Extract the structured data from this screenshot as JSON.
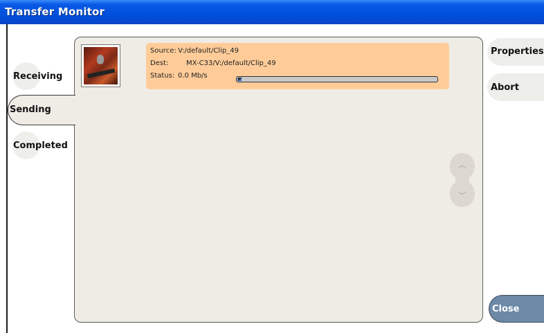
{
  "window": {
    "title": "Transfer Monitor"
  },
  "tabs": {
    "receiving": "Receiving",
    "sending": "Sending",
    "completed": "Completed"
  },
  "transfer": {
    "source_label": "Source:",
    "source_value": "V:/default/Clip_49",
    "dest_label": "Dest:",
    "dest_value": "MX-C33/V:/default/Clip_49",
    "status_label": "Status:",
    "status_value": "0.0 Mb/s",
    "progress": 0.02
  },
  "actions": {
    "properties": "Properties",
    "abort": "Abort",
    "close": "Close"
  },
  "colors": {
    "title_bar": "#0050de",
    "item_highlight": "#ffcc99",
    "close_button": "#6c8aa8"
  }
}
